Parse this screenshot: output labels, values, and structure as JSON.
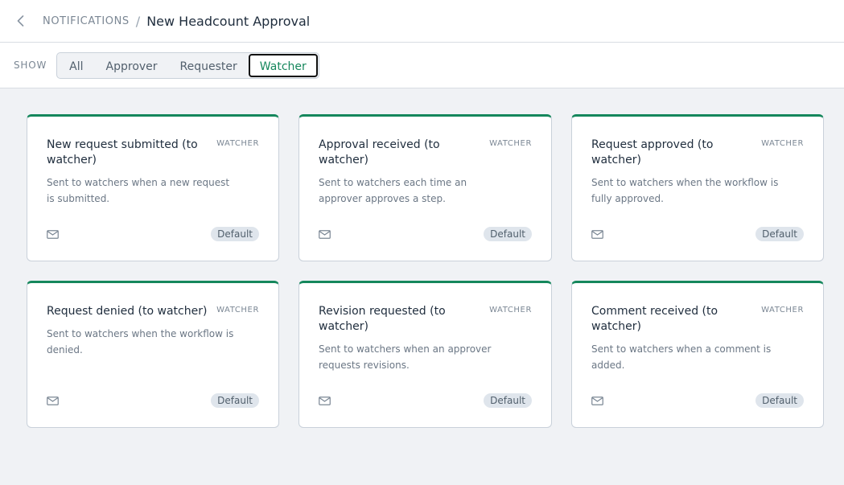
{
  "breadcrumb": {
    "parent": "NOTIFICATIONS",
    "separator": "/",
    "title": "New Headcount Approval"
  },
  "filter": {
    "label": "SHOW",
    "options": [
      {
        "label": "All",
        "active": false
      },
      {
        "label": "Approver",
        "active": false
      },
      {
        "label": "Requester",
        "active": false
      },
      {
        "label": "Watcher",
        "active": true
      }
    ]
  },
  "icons": {
    "back": "chevron-left-icon",
    "mail": "mail-icon"
  },
  "colors": {
    "accent": "#15875c",
    "badge_bg": "#dfe5ec",
    "background": "#f0f2f5"
  },
  "cards": [
    {
      "title": "New request submitted (to watcher)",
      "tag": "WATCHER",
      "description": "Sent to watchers when a new request is submitted.",
      "badge": "Default"
    },
    {
      "title": "Approval received (to watcher)",
      "tag": "WATCHER",
      "description": "Sent to watchers each time an approver approves a step.",
      "badge": "Default"
    },
    {
      "title": "Request approved (to watcher)",
      "tag": "WATCHER",
      "description": "Sent to watchers when the workflow is fully approved.",
      "badge": "Default"
    },
    {
      "title": "Request denied (to watcher)",
      "tag": "WATCHER",
      "description": "Sent to watchers when the workflow is denied.",
      "badge": "Default"
    },
    {
      "title": "Revision requested (to watcher)",
      "tag": "WATCHER",
      "description": "Sent to watchers when an approver requests revisions.",
      "badge": "Default"
    },
    {
      "title": "Comment received (to watcher)",
      "tag": "WATCHER",
      "description": "Sent to watchers when a comment is added.",
      "badge": "Default"
    }
  ]
}
